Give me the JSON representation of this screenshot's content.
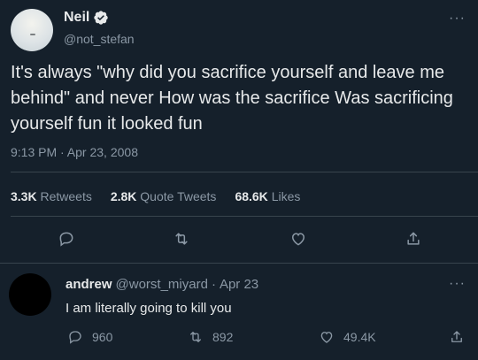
{
  "tweet": {
    "author_name": "Neil",
    "author_handle": "@not_stefan",
    "text": "It's always \"why did you sacrifice yourself and leave me behind\" and never How was the sacrifice Was sacrificing yourself fun it looked fun",
    "timestamp": "9:13 PM · Apr 23, 2008",
    "stats": {
      "retweets_count": "3.3K",
      "retweets_label": "Retweets",
      "quote_count": "2.8K",
      "quote_label": "Quote Tweets",
      "likes_count": "68.6K",
      "likes_label": "Likes"
    },
    "more_label": "···"
  },
  "reply": {
    "author_name": "andrew",
    "author_handle": "@worst_miyard",
    "separator": "·",
    "date": "Apr 23",
    "text": "I am literally going to kill you",
    "reply_count": "960",
    "retweet_count": "892",
    "like_count": "49.4K",
    "more_label": "···"
  },
  "icons": {
    "verified": "verified-badge-icon",
    "reply": "reply-icon",
    "retweet": "retweet-icon",
    "like": "heart-icon",
    "share": "share-icon"
  },
  "colors": {
    "background": "#15202b",
    "text_primary": "#e7e9ea",
    "text_secondary": "#8b98a5",
    "divider": "#38444d"
  }
}
